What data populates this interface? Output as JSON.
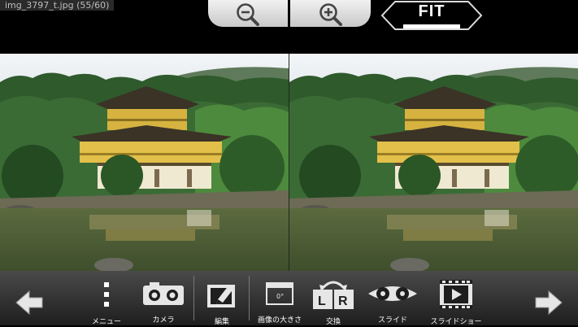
{
  "header": {
    "file_label": "img_3797_t.jpg  (55/60)",
    "zoom_out_icon": "zoom-out-icon",
    "zoom_in_icon": "zoom-in-icon",
    "fit_label": "FIT"
  },
  "toolbar": {
    "prev_icon": "arrow-left-icon",
    "next_icon": "arrow-right-icon",
    "items": [
      {
        "id": "menu",
        "label": "メニュー",
        "icon": "vertical-dots-icon"
      },
      {
        "id": "camera",
        "label": "カメラ",
        "icon": "stereo-camera-icon"
      },
      {
        "id": "edit",
        "label": "編集",
        "icon": "edit-icon"
      },
      {
        "id": "image_size",
        "label": "画像の大きさ",
        "icon": "window-icon"
      },
      {
        "id": "swap",
        "label": "交換",
        "icon": "swap-lr-icon"
      },
      {
        "id": "slideshow",
        "label": "スライド",
        "icon": "glasses-icon"
      },
      {
        "id": "play",
        "label": "スライドショー",
        "icon": "film-play-icon"
      }
    ]
  },
  "colors": {
    "toolbar_bg": "#2e2e2e",
    "button_silver": "#d9d9d9"
  }
}
